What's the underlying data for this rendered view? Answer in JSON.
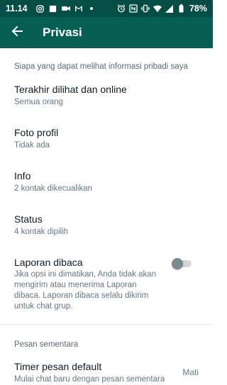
{
  "status_bar": {
    "time": "11.14",
    "battery": "78%",
    "icons": [
      "instagram-icon",
      "square-icon",
      "video-icon",
      "gmail-icon",
      "dot-icon",
      "alarm-icon",
      "nfc-icon",
      "vibrate-icon",
      "wifi-icon",
      "signal-icon",
      "battery-icon"
    ]
  },
  "app_bar": {
    "title": "Privasi",
    "back_icon": "arrow-left-icon"
  },
  "section1": {
    "header": "Siapa yang dapat melihat informasi pribadi saya",
    "items": [
      {
        "title": "Terakhir dilihat dan online",
        "sub": "Semua orang"
      },
      {
        "title": "Foto profil",
        "sub": "Tidak ada"
      },
      {
        "title": "Info",
        "sub": "2 kontak dikecualikan"
      },
      {
        "title": "Status",
        "sub": "4 kontak dipilih"
      }
    ],
    "read_receipts": {
      "title": "Laporan dibaca",
      "description": "Jika opsi ini dimatikan, Anda tidak akan mengirim atau menerima Laporan dibaca. Laporan dibaca selalu dikirim untuk chat grup.",
      "enabled": false
    }
  },
  "section2": {
    "header": "Pesan sementara",
    "timer": {
      "title": "Timer pesan default",
      "sub": "Mulai chat baru dengan pesan sementara",
      "value": "Mati"
    }
  },
  "colors": {
    "status_bar": "#054d44",
    "app_bar": "#075e54",
    "toggle_off_thumb": "#7a8a93"
  }
}
